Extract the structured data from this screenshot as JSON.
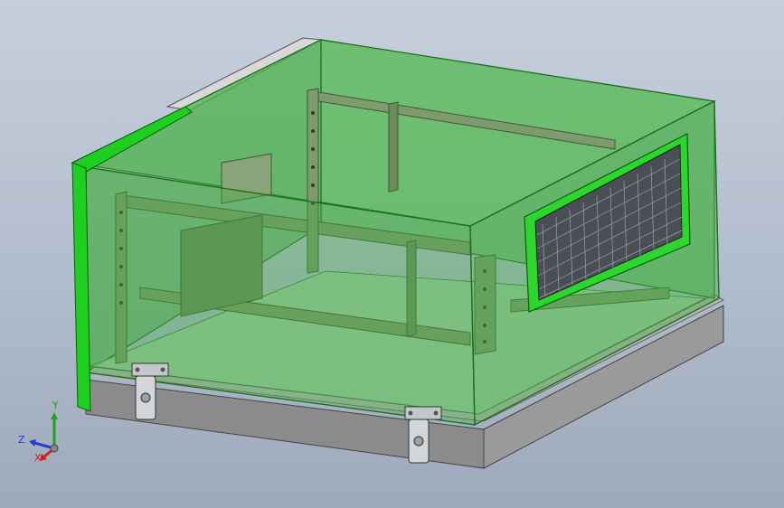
{
  "viewport": {
    "background_top": "#c7cfdc",
    "background_bottom": "#9ea9bb"
  },
  "model": {
    "glass_color": "#3fa83f",
    "edge_color": "#1f6e1f",
    "frame_color": "#6f8a5f",
    "base_color": "#8a8a8a",
    "latch_color": "#c4c8cc"
  },
  "triad": {
    "x_label": "X",
    "y_label": "Y",
    "z_label": "Z",
    "x_color": "#d02020",
    "y_color": "#20a020",
    "z_color": "#2040d0"
  }
}
